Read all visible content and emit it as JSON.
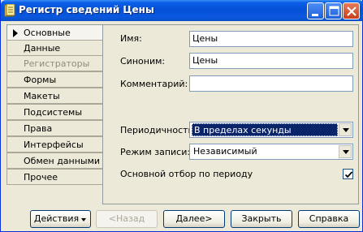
{
  "window": {
    "title": "Регистр сведений Цены"
  },
  "tabs": [
    {
      "label": "Основные",
      "active": true,
      "disabled": false
    },
    {
      "label": "Данные",
      "active": false,
      "disabled": false
    },
    {
      "label": "Регистраторы",
      "active": false,
      "disabled": true
    },
    {
      "label": "Формы",
      "active": false,
      "disabled": false
    },
    {
      "label": "Макеты",
      "active": false,
      "disabled": false
    },
    {
      "label": "Подсистемы",
      "active": false,
      "disabled": false
    },
    {
      "label": "Права",
      "active": false,
      "disabled": false
    },
    {
      "label": "Интерфейсы",
      "active": false,
      "disabled": false
    },
    {
      "label": "Обмен данными",
      "active": false,
      "disabled": false
    },
    {
      "label": "Прочее",
      "active": false,
      "disabled": false
    }
  ],
  "form": {
    "name_label": "Имя:",
    "name_value": "Цены",
    "synonym_label": "Синоним:",
    "synonym_value": "Цены",
    "comment_label": "Комментарий:",
    "comment_value": "",
    "periodicity_label": "Периодичность:",
    "periodicity_value": "В пределах секунды",
    "write_mode_label": "Режим записи:",
    "write_mode_value": "Независимый",
    "main_filter_label": "Основной отбор по периоду",
    "main_filter_checked": true
  },
  "buttons": {
    "actions": "Действия",
    "back": "<Назад",
    "next": "Далее>",
    "close": "Закрыть",
    "help": "Справка"
  }
}
